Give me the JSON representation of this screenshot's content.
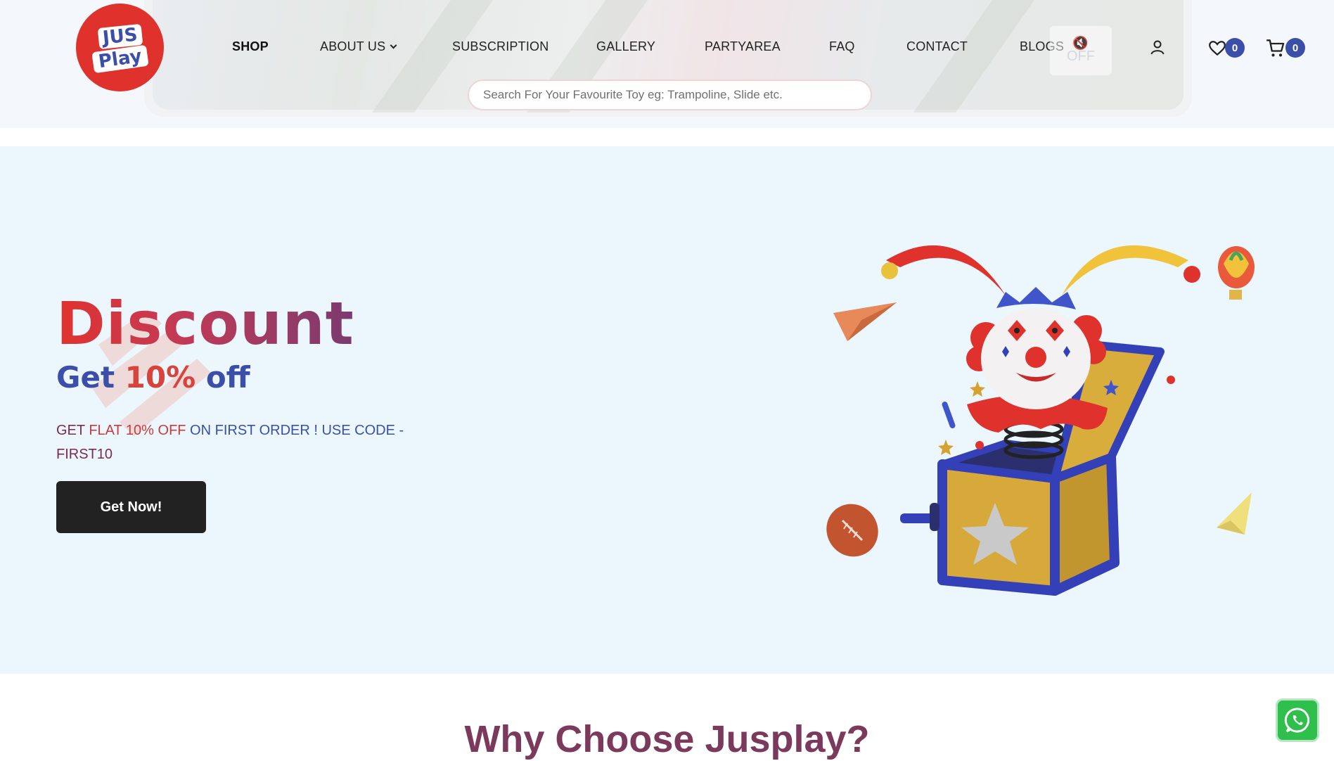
{
  "header": {
    "logo": {
      "line1": "JUS",
      "line2": "Play"
    },
    "nav": [
      {
        "label": "SHOP",
        "active": true
      },
      {
        "label": "ABOUT US",
        "has_dropdown": true
      },
      {
        "label": "SUBSCRIPTION"
      },
      {
        "label": "GALLERY"
      },
      {
        "label": "PARTYAREA"
      },
      {
        "label": "FAQ"
      },
      {
        "label": "CONTACT"
      },
      {
        "label": "BLOGS"
      }
    ],
    "mute_label": "OFF",
    "wishlist_count": "0",
    "cart_count": "0",
    "search_placeholder": "Search For Your Favourite Toy eg: Trampoline, Slide etc.",
    "search_value": ""
  },
  "hero": {
    "title": "Discount",
    "subtitle_prefix": "Get ",
    "subtitle_highlight": "10%",
    "subtitle_suffix": " off",
    "desc_part1": "GET ",
    "desc_part2": "FLAT 10% OFF",
    "desc_part3": " ON FIRST ORDER ! USE CODE - ",
    "desc_part4": "FIRST10",
    "cta_label": "Get Now!"
  },
  "section": {
    "why_title": "Why Choose Jusplay?"
  },
  "colors": {
    "brand_red": "#e0322d",
    "brand_blue": "#3b4fa8",
    "hero_bg": "#ebf6fd",
    "cta_bg": "#222222",
    "whatsapp": "#2fbf4d"
  }
}
